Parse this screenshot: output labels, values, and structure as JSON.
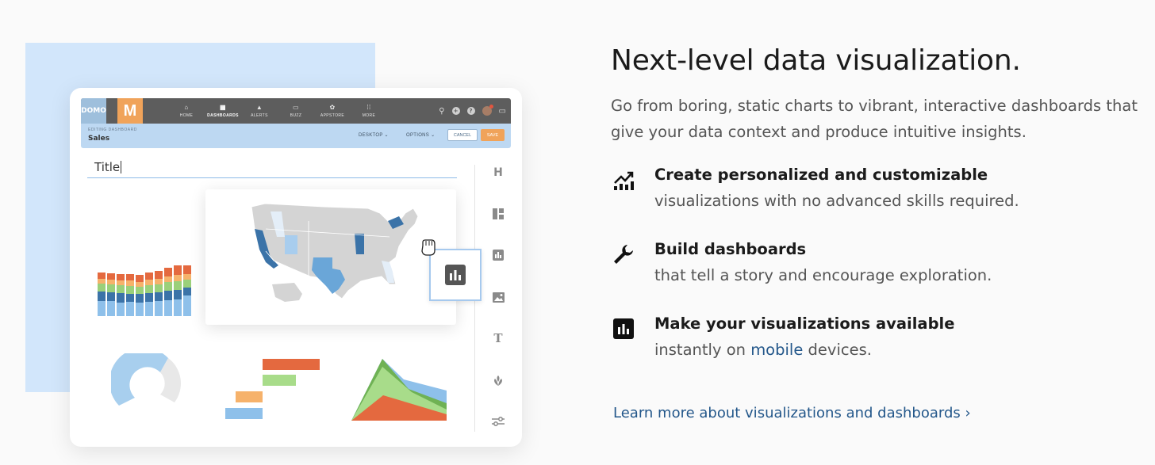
{
  "mockup": {
    "domo_logo": "DOMO",
    "m_logo": "M",
    "nav": [
      {
        "label": "HOME",
        "icon": "home-icon"
      },
      {
        "label": "DASHBOARDS",
        "icon": "dashboards-icon"
      },
      {
        "label": "ALERTS",
        "icon": "alerts-icon"
      },
      {
        "label": "BUZZ",
        "icon": "buzz-icon"
      },
      {
        "label": "APPSTORE",
        "icon": "appstore-icon"
      },
      {
        "label": "MORE",
        "icon": "more-icon"
      }
    ],
    "editing_label": "EDITING DASHBOARD",
    "dashboard_name": "Sales",
    "desktop_label": "DESKTOP",
    "options_label": "OPTIONS",
    "cancel_label": "CANCEL",
    "save_label": "SAVE",
    "title_value": "Title",
    "tools": [
      "header-tool-icon",
      "layout-tool-icon",
      "chart-tool-icon",
      "image-tool-icon",
      "text-tool-icon",
      "app-tool-icon",
      "filter-tool-icon"
    ],
    "header_tool_glyph": "H",
    "text_tool_glyph": "T",
    "colors": {
      "orange": "#e4693f",
      "yellow": "#f6b26b",
      "green": "#9bd07a",
      "blue": "#8ec0ea",
      "dark_blue": "#3b73a8"
    }
  },
  "content": {
    "heading": "Next-level data visualization.",
    "subheading": "Go from boring, static charts to vibrant, interactive dashboards that give your data context and produce intuitive insights.",
    "features": [
      {
        "icon": "chart-trend-icon",
        "title": "Create personalized and customizable",
        "desc": "visualizations with no advanced skills required."
      },
      {
        "icon": "wrench-icon",
        "title": "Build dashboards",
        "desc": "that tell a story and encourage exploration."
      },
      {
        "icon": "bar-chart-square-icon",
        "title": "Make your visualizations available",
        "desc_before": "instantly on ",
        "desc_link": "mobile",
        "desc_after": " devices."
      }
    ],
    "learn_more": "Learn more about visualizations and dashboards ›"
  }
}
